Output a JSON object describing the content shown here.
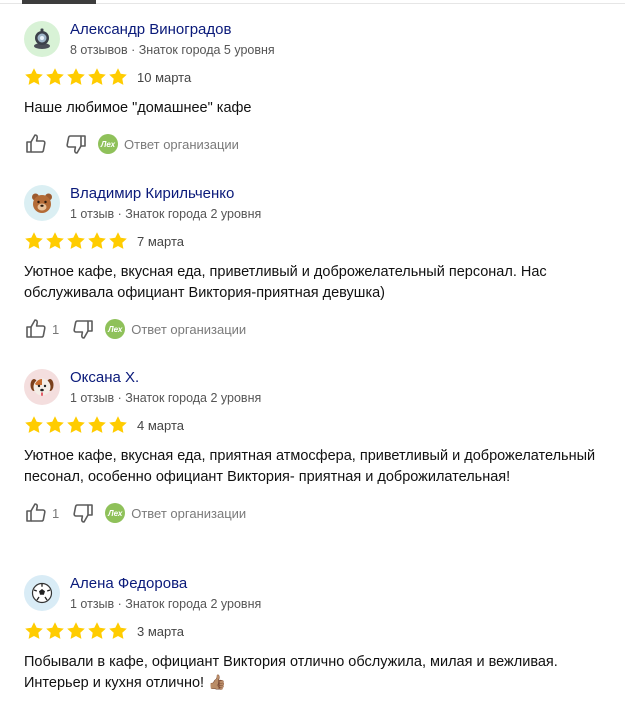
{
  "org_reply_label": "Ответ организации",
  "org_badge_text": "Лех",
  "reviews": [
    {
      "author": "Александр Виноградов",
      "meta": "8 отзывов · Знаток города 5 уровня",
      "rating": 5,
      "date": "10 марта",
      "text": "Наше любимое \"домашнее\" кафе",
      "likes": "",
      "avatar_icon": "robot-avatar-icon"
    },
    {
      "author": "Владимир Кирильченко",
      "meta": "1 отзыв · Знаток города 2 уровня",
      "rating": 5,
      "date": "7 марта",
      "text": "Уютное кафе, вкусная еда, приветливый и доброжелательный персонал. Нас обслуживала официант Виктория-приятная девушка)",
      "likes": "1",
      "avatar_icon": "bear-avatar-icon"
    },
    {
      "author": "Оксана Х.",
      "meta": "1 отзыв · Знаток города 2 уровня",
      "rating": 5,
      "date": "4 марта",
      "text": "Уютное кафе, вкусная еда, приятная атмосфера, приветливый и доброжелательный песонал, особенно официант Виктория- приятная и доброжилательная!",
      "likes": "1",
      "avatar_icon": "dog-avatar-icon"
    },
    {
      "author": "Алена Федорова",
      "meta": "1 отзыв · Знаток города 2 уровня",
      "rating": 5,
      "date": "3 марта",
      "text": "Побывали в кафе, официант Виктория отлично обслужила, милая и вежливая. Интерьер и кухня отлично! 👍🏽",
      "likes": "",
      "avatar_icon": "soccer-ball-avatar-icon"
    }
  ]
}
